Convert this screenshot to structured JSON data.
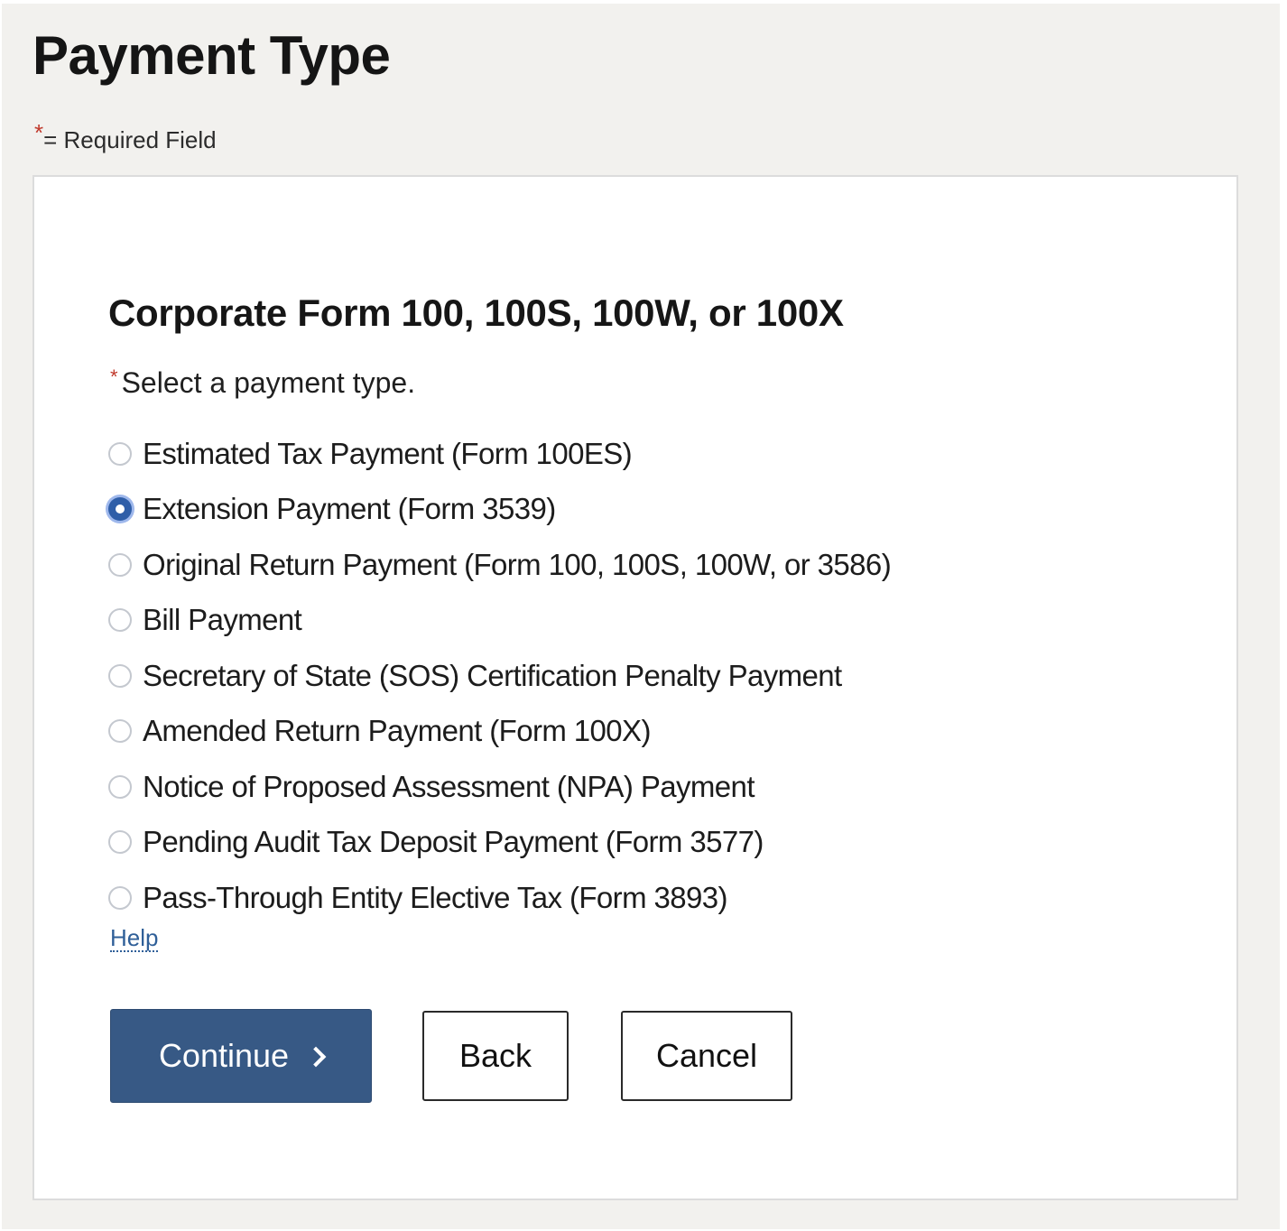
{
  "page": {
    "title": "Payment Type",
    "required_note": {
      "asterisk": "*",
      "text": "= Required Field"
    }
  },
  "form": {
    "section_title": "Corporate Form 100, 100S, 100W, or 100X",
    "prompt": {
      "asterisk": "*",
      "text": "Select a payment type."
    },
    "payment_options": [
      {
        "label": "Estimated Tax Payment (Form 100ES)",
        "checked": false
      },
      {
        "label": "Extension Payment (Form 3539)",
        "checked": true
      },
      {
        "label": "Original Return Payment (Form 100, 100S, 100W, or 3586)",
        "checked": false
      },
      {
        "label": "Bill Payment",
        "checked": false
      },
      {
        "label": "Secretary of State (SOS) Certification Penalty Payment",
        "checked": false
      },
      {
        "label": "Amended Return Payment (Form 100X)",
        "checked": false
      },
      {
        "label": "Notice of Proposed Assessment (NPA) Payment",
        "checked": false
      },
      {
        "label": "Pending Audit Tax Deposit Payment (Form 3577)",
        "checked": false
      },
      {
        "label": "Pass-Through Entity Elective Tax (Form 3893)",
        "checked": false
      }
    ],
    "selected_option": "Extension Payment (Form 3539)",
    "help_link": "Help"
  },
  "actions": {
    "continue_label": "Continue",
    "back_label": "Back",
    "cancel_label": "Cancel"
  },
  "colors": {
    "primary_button": "#375985",
    "radio_selected": "#2f5ea8",
    "required_asterisk": "#c0392b",
    "link": "#2f5f98",
    "page_background": "#f2f1ee"
  }
}
